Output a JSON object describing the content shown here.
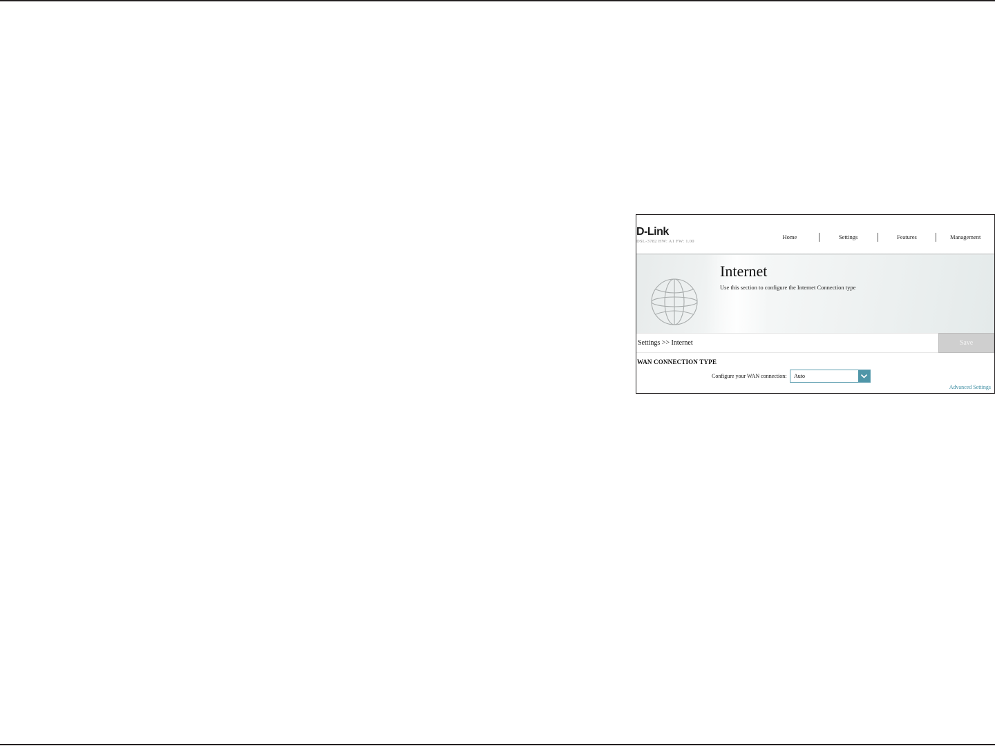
{
  "header": {
    "logo_text": "D-Link",
    "model_info": "DSL-3782  HW: A1  FW: 1.00",
    "nav": [
      {
        "label": "Home"
      },
      {
        "label": "Settings"
      },
      {
        "label": "Features"
      },
      {
        "label": "Management"
      }
    ]
  },
  "banner": {
    "title": "Internet",
    "description": "Use this section to configure the Internet Connection type",
    "icon": "globe-icon"
  },
  "toolbar": {
    "breadcrumb": "Settings >> Internet",
    "save_label": "Save"
  },
  "wan": {
    "section_title": "WAN CONNECTION TYPE",
    "field_label": "Configure your WAN connection:",
    "selected_value": "Auto",
    "advanced_link": "Advanced Settings"
  },
  "colors": {
    "accent": "#4f96a8",
    "link": "#3f8ea3",
    "save_disabled": "#cfcfcf"
  }
}
